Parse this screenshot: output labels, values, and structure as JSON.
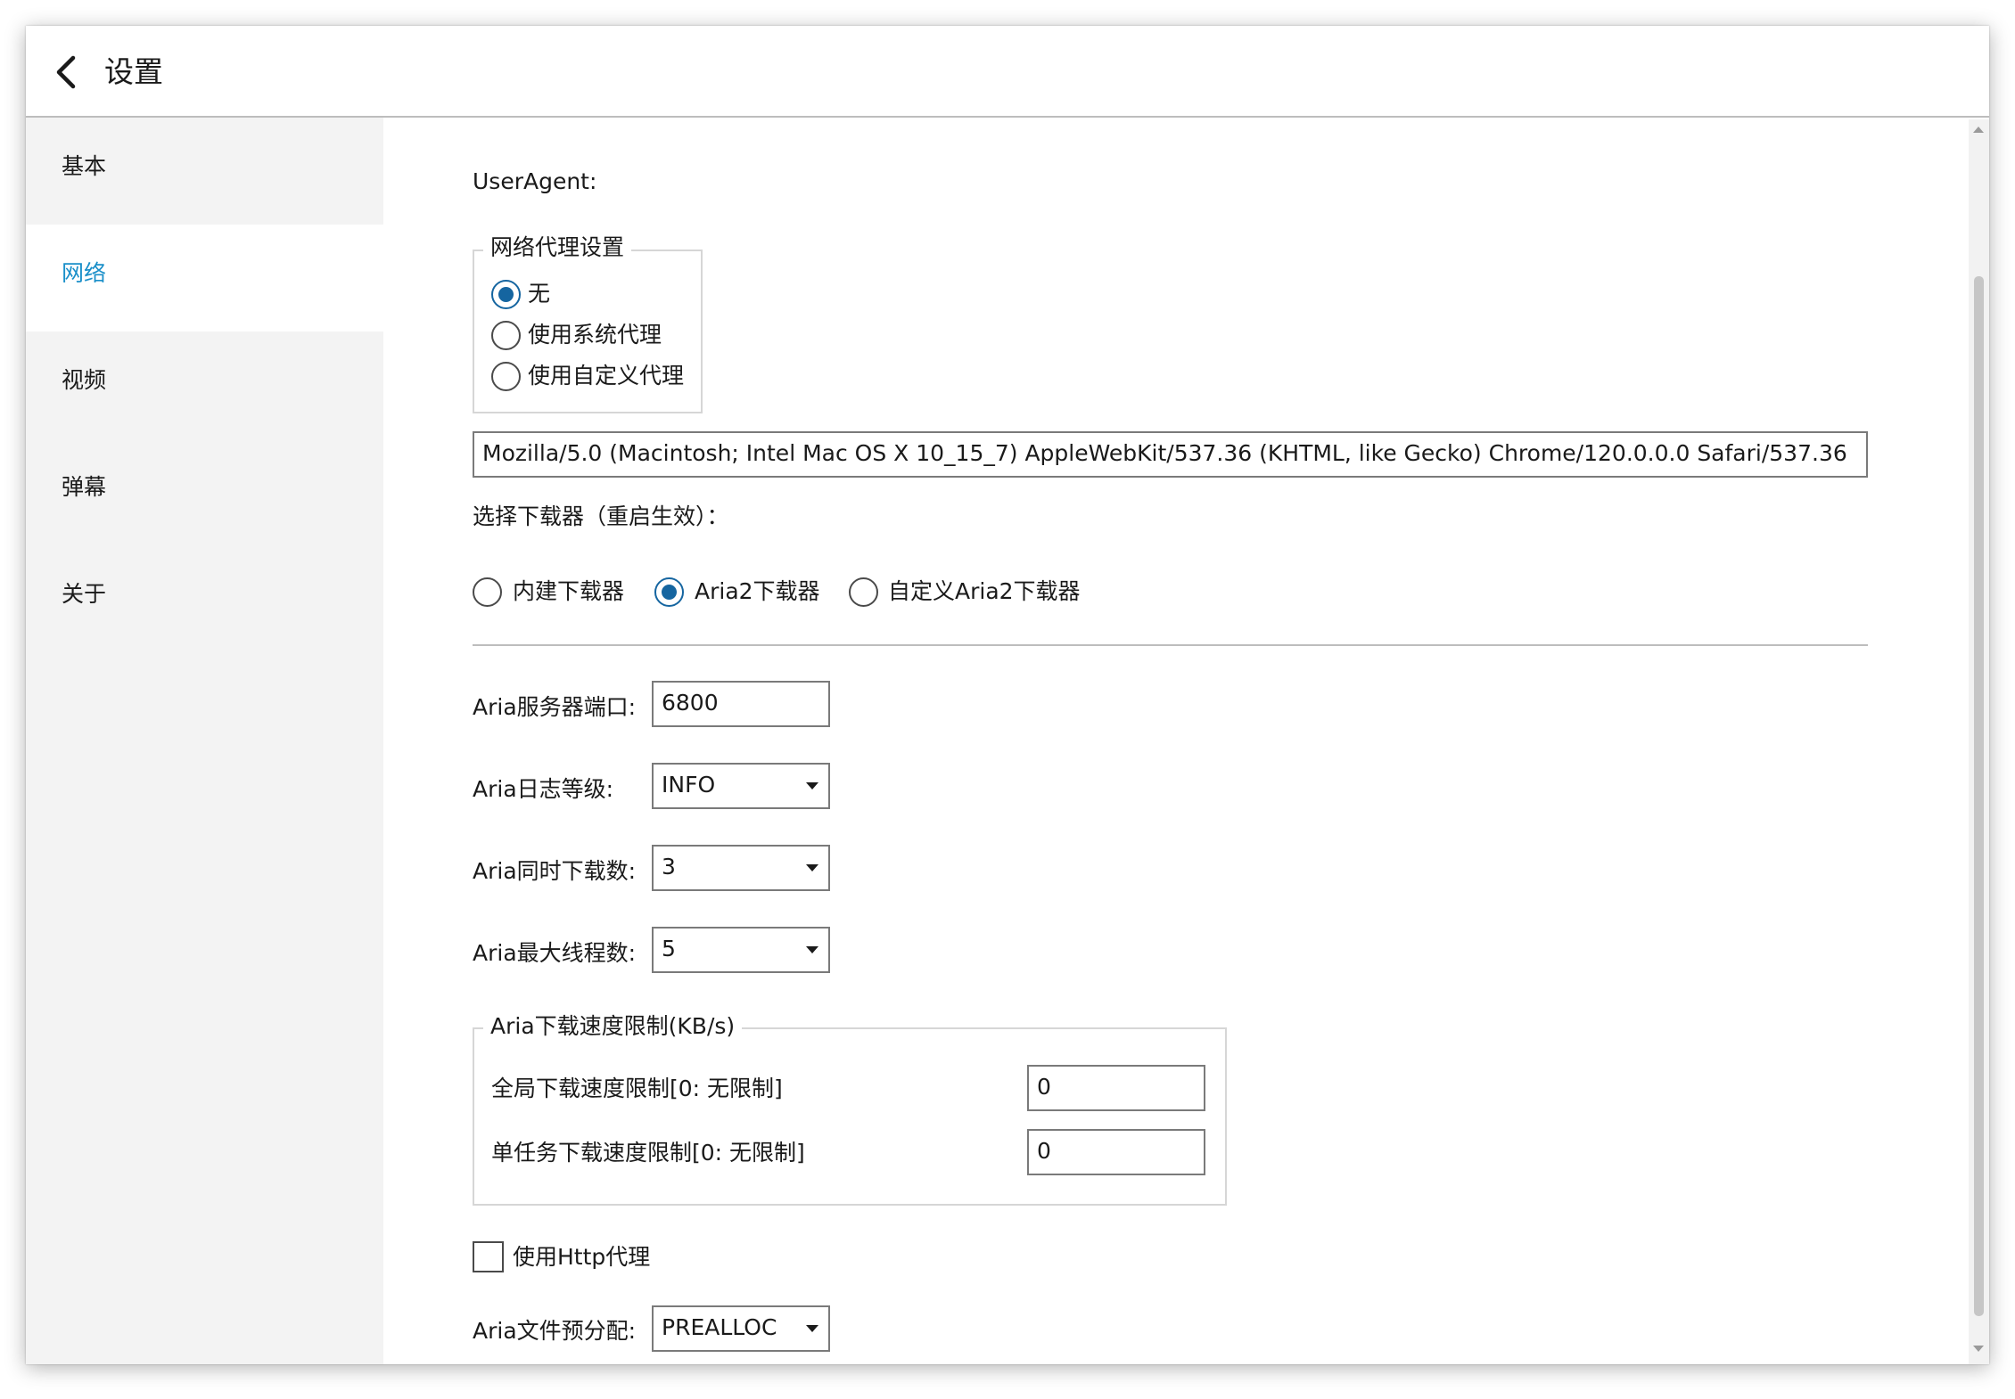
{
  "header": {
    "title": "设置",
    "back_icon": "chevron-left-icon"
  },
  "sidebar": {
    "items": [
      {
        "label": "基本"
      },
      {
        "label": "网络"
      },
      {
        "label": "视频"
      },
      {
        "label": "弹幕"
      },
      {
        "label": "关于"
      }
    ],
    "active_index": 1
  },
  "content": {
    "useragent_label": "UserAgent:",
    "proxy": {
      "legend": "网络代理设置",
      "options": [
        "无",
        "使用系统代理",
        "使用自定义代理"
      ],
      "selected": "无"
    },
    "useragent_value": "Mozilla/5.0 (Macintosh; Intel Mac OS X 10_15_7) AppleWebKit/537.36 (KHTML, like Gecko) Chrome/120.0.0.0 Safari/537.36",
    "downloader": {
      "label": "选择下载器（重启生效）：",
      "options": [
        "内建下载器",
        "Aria2下载器",
        "自定义Aria2下载器"
      ],
      "selected": "Aria2下载器"
    },
    "aria": {
      "port_label": "Aria服务器端口:",
      "port_value": "6800",
      "log_label": "Aria日志等级:",
      "log_value": "INFO",
      "concurrent_label": "Aria同时下载数:",
      "concurrent_value": "3",
      "threads_label": "Aria最大线程数:",
      "threads_value": "5",
      "speed": {
        "legend": "Aria下载速度限制(KB/s)",
        "global_label": "全局下载速度限制[0: 无限制]",
        "global_value": "0",
        "task_label": "单任务下载速度限制[0: 无限制]",
        "task_value": "0"
      },
      "http_proxy_label": "使用Http代理",
      "http_proxy_checked": false,
      "prealloc_label": "Aria文件预分配:",
      "prealloc_value": "PREALLOC"
    }
  },
  "colors": {
    "accent": "#1a8fc9",
    "radio_selected": "#1565a0",
    "sidebar_bg": "#f3f3f3"
  }
}
